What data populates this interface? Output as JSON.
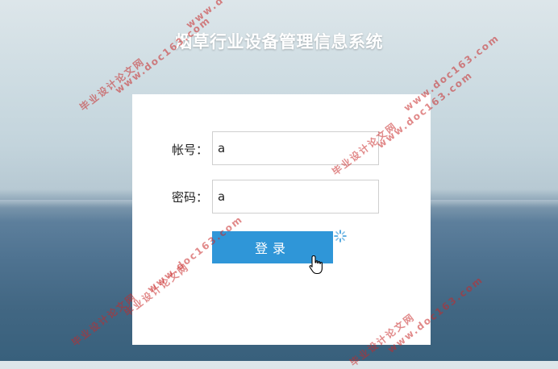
{
  "header": {
    "title": "烟草行业设备管理信息系统"
  },
  "login_form": {
    "account_label": "帐号：",
    "account_value": "a",
    "password_label": "密码：",
    "password_value": "a",
    "submit_label": "登录"
  },
  "watermark": {
    "line1": "毕业设计论文网",
    "line2": "www.doc163.com"
  },
  "colors": {
    "accent": "#2f96d8",
    "watermark": "#c82828"
  }
}
